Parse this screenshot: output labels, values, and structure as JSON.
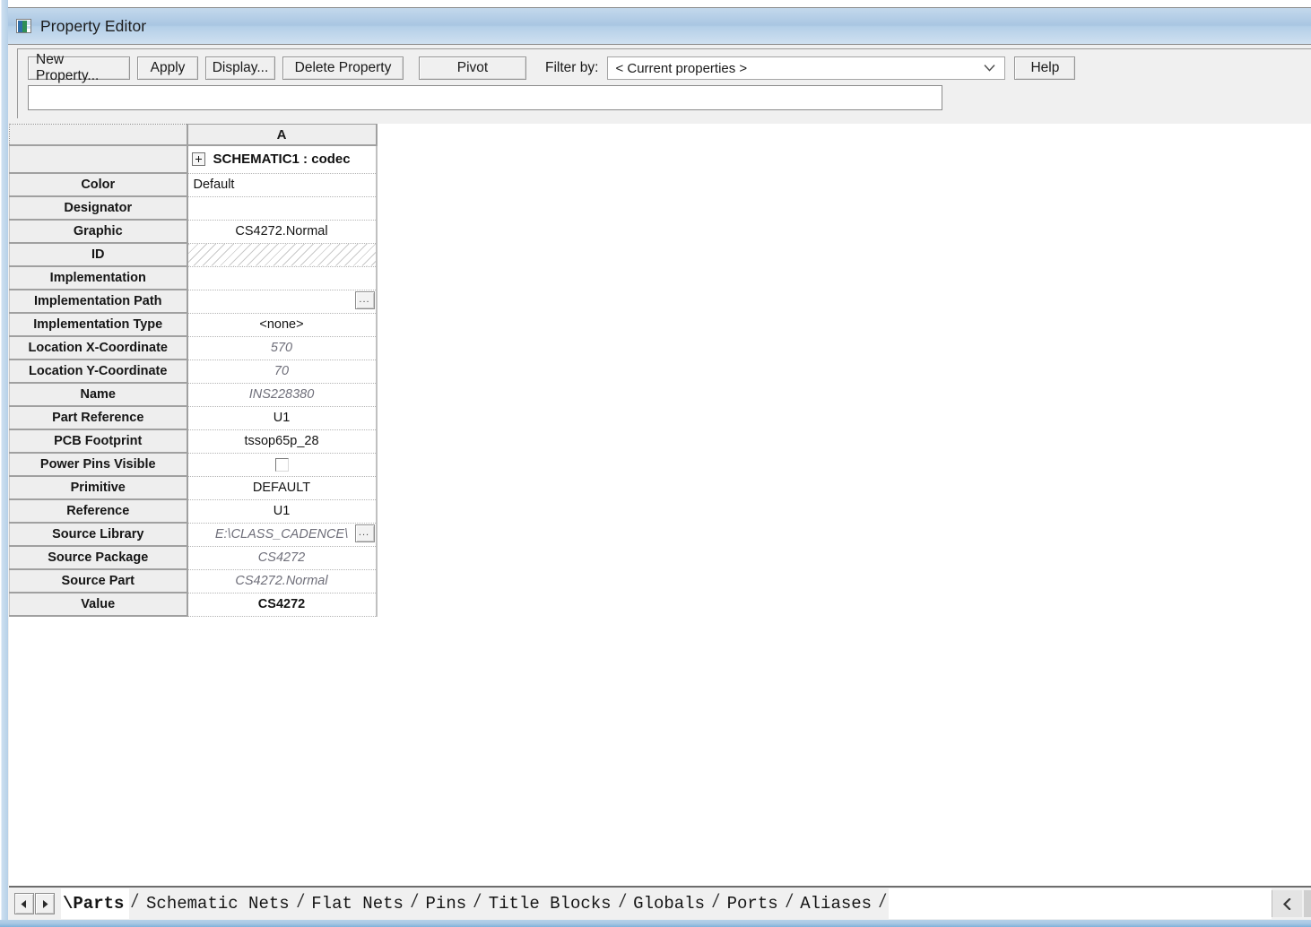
{
  "window": {
    "title": "Property Editor",
    "icon": "property-editor-icon"
  },
  "toolbar": {
    "new_property_label": "New Property...",
    "apply_label": "Apply",
    "display_label": "Display...",
    "delete_property_label": "Delete Property",
    "pivot_label": "Pivot",
    "filter_label": "Filter by:",
    "filter_value": "< Current properties >",
    "filter_options": [
      "< Current properties >"
    ],
    "help_label": "Help",
    "property_input_value": "",
    "property_input_placeholder": ""
  },
  "grid": {
    "header": {
      "corner": "",
      "column_a": "A"
    },
    "object_row": {
      "label": "",
      "title": "SCHEMATIC1 : codec",
      "expander": "plus-icon"
    },
    "rows": [
      {
        "name": "Color",
        "value": "Default",
        "style": "normal",
        "align": "left"
      },
      {
        "name": "Designator",
        "value": "",
        "style": "normal",
        "align": "center"
      },
      {
        "name": "Graphic",
        "value": "CS4272.Normal",
        "style": "normal",
        "align": "center"
      },
      {
        "name": "ID",
        "value": "",
        "style": "hatched",
        "align": "center"
      },
      {
        "name": "Implementation",
        "value": "",
        "style": "normal",
        "align": "center"
      },
      {
        "name": "Implementation Path",
        "value": "",
        "style": "browse",
        "align": "center"
      },
      {
        "name": "Implementation Type",
        "value": "<none>",
        "style": "normal",
        "align": "center"
      },
      {
        "name": "Location X-Coordinate",
        "value": "570",
        "style": "readonly",
        "align": "center"
      },
      {
        "name": "Location Y-Coordinate",
        "value": "70",
        "style": "readonly",
        "align": "center"
      },
      {
        "name": "Name",
        "value": "INS228380",
        "style": "readonly",
        "align": "center"
      },
      {
        "name": "Part Reference",
        "value": "U1",
        "style": "normal",
        "align": "center"
      },
      {
        "name": "PCB Footprint",
        "value": "tssop65p_28",
        "style": "normal",
        "align": "center"
      },
      {
        "name": "Power Pins Visible",
        "value": "",
        "style": "checkbox",
        "align": "center",
        "checked": false
      },
      {
        "name": "Primitive",
        "value": "DEFAULT",
        "style": "normal",
        "align": "center"
      },
      {
        "name": "Reference",
        "value": "U1",
        "style": "normal",
        "align": "center"
      },
      {
        "name": "Source Library",
        "value": "E:\\CLASS_CADENCE\\",
        "style": "readonly-browse",
        "align": "center"
      },
      {
        "name": "Source Package",
        "value": "CS4272",
        "style": "readonly",
        "align": "center"
      },
      {
        "name": "Source Part",
        "value": "CS4272.Normal",
        "style": "readonly",
        "align": "center"
      },
      {
        "name": "Value",
        "value": "CS4272",
        "style": "bold",
        "align": "center"
      }
    ],
    "browse_button_label": "..."
  },
  "tabbar": {
    "prev_icon": "triangle-left-icon",
    "next_icon": "triangle-right-icon",
    "scroll_right_icon": "chevron-left-icon",
    "separator": "/",
    "tabs": [
      {
        "label": "\\Parts",
        "active": true
      },
      {
        "label": "Schematic Nets",
        "active": false
      },
      {
        "label": "Flat Nets",
        "active": false
      },
      {
        "label": "Pins",
        "active": false
      },
      {
        "label": "Title Blocks",
        "active": false
      },
      {
        "label": "Globals",
        "active": false
      },
      {
        "label": "Ports",
        "active": false
      },
      {
        "label": "Aliases",
        "active": false
      }
    ]
  },
  "colors": {
    "titlebar_top": "#c3d8ec",
    "titlebar_bottom": "#cfe0f0",
    "window_border": "#b6d0e8",
    "panel_bg": "#f0f0f0",
    "header_cell_bg": "#eeeeee",
    "readonly_text": "#6f6f7a",
    "grid_line": "#a0a0a0"
  }
}
